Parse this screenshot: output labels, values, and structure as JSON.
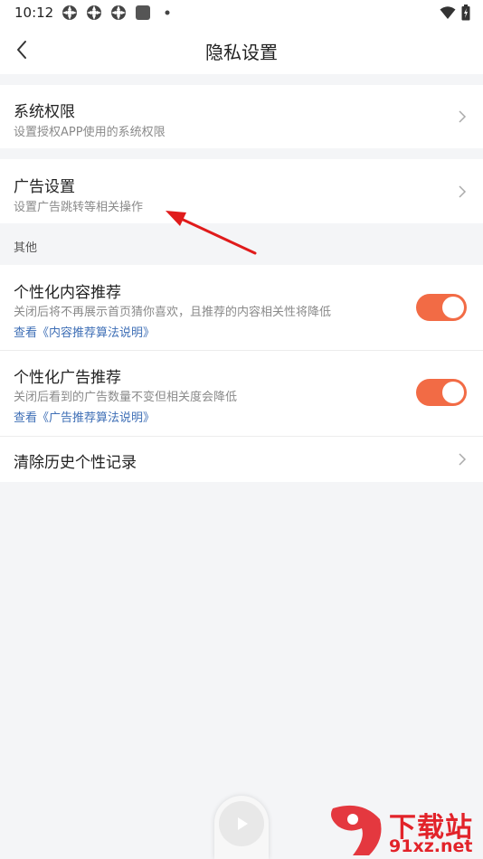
{
  "status_bar": {
    "time": "10:12"
  },
  "header": {
    "title": "隐私设置"
  },
  "items": {
    "system_permission": {
      "title": "系统权限",
      "subtitle": "设置授权APP使用的系统权限"
    },
    "ad_settings": {
      "title": "广告设置",
      "subtitle": "设置广告跳转等相关操作"
    }
  },
  "section_other": {
    "label": "其他"
  },
  "personalized_content": {
    "title": "个性化内容推荐",
    "subtitle": "关闭后将不再展示首页猜你喜欢，且推荐的内容相关性将降低",
    "link": "查看《内容推荐算法说明》",
    "enabled": true
  },
  "personalized_ads": {
    "title": "个性化广告推荐",
    "subtitle": "关闭后看到的广告数量不变但相关度会降低",
    "link": "查看《广告推荐算法说明》",
    "enabled": true
  },
  "clear_history": {
    "title": "清除历史个性记录"
  },
  "watermark": {
    "line1": "下载站",
    "line2": "91xz.net"
  },
  "colors": {
    "toggle_on": "#f26b45",
    "link": "#3f6fb6",
    "annotation_arrow": "#e01b1b"
  }
}
